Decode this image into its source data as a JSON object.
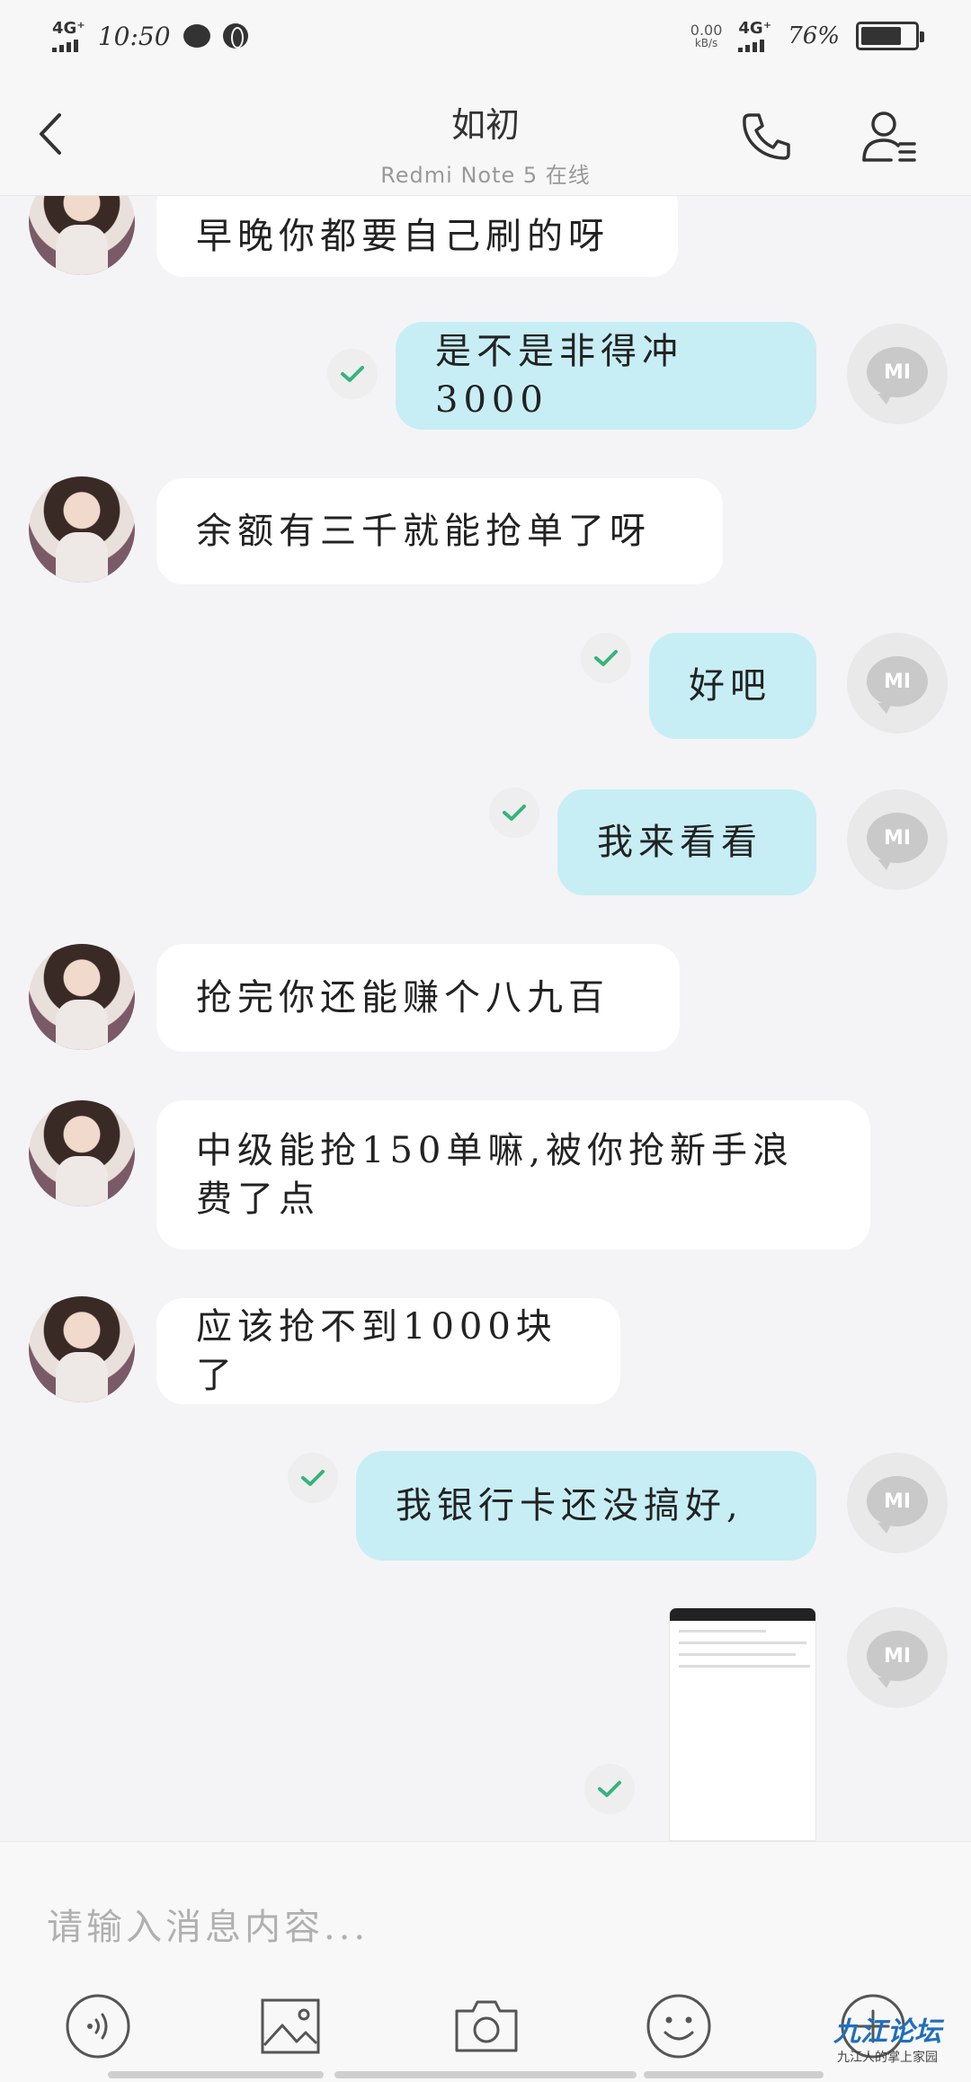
{
  "status_bar": {
    "network_left": "4G⁺",
    "time": "10:50",
    "speed_value": "0.00",
    "speed_unit": "kB/s",
    "network_right": "4G⁺",
    "battery": "76%",
    "battery_level": 0.76
  },
  "header": {
    "title": "如初",
    "subtitle": "Redmi Note 5 在线"
  },
  "messages": [
    {
      "side": "in",
      "text": "早晚你都要自己刷的呀"
    },
    {
      "side": "out",
      "text": "是不是非得冲3000"
    },
    {
      "side": "in",
      "text": "余额有三千就能抢单了呀"
    },
    {
      "side": "out",
      "text": "好吧"
    },
    {
      "side": "out",
      "text": "我来看看"
    },
    {
      "side": "in",
      "text": "抢完你还能赚个八九百"
    },
    {
      "side": "in",
      "text": "中级能抢150单嘛,被你抢新手浪",
      "text2": "费了点"
    },
    {
      "side": "in",
      "text": "应该抢不到1000块了"
    },
    {
      "side": "out",
      "text": "我银行卡还没搞好,"
    }
  ],
  "self_avatar_label": "MI",
  "input": {
    "placeholder": "请输入消息内容..."
  },
  "watermark": {
    "logo": "九江论坛",
    "tagline": "九江人的掌上家园"
  }
}
